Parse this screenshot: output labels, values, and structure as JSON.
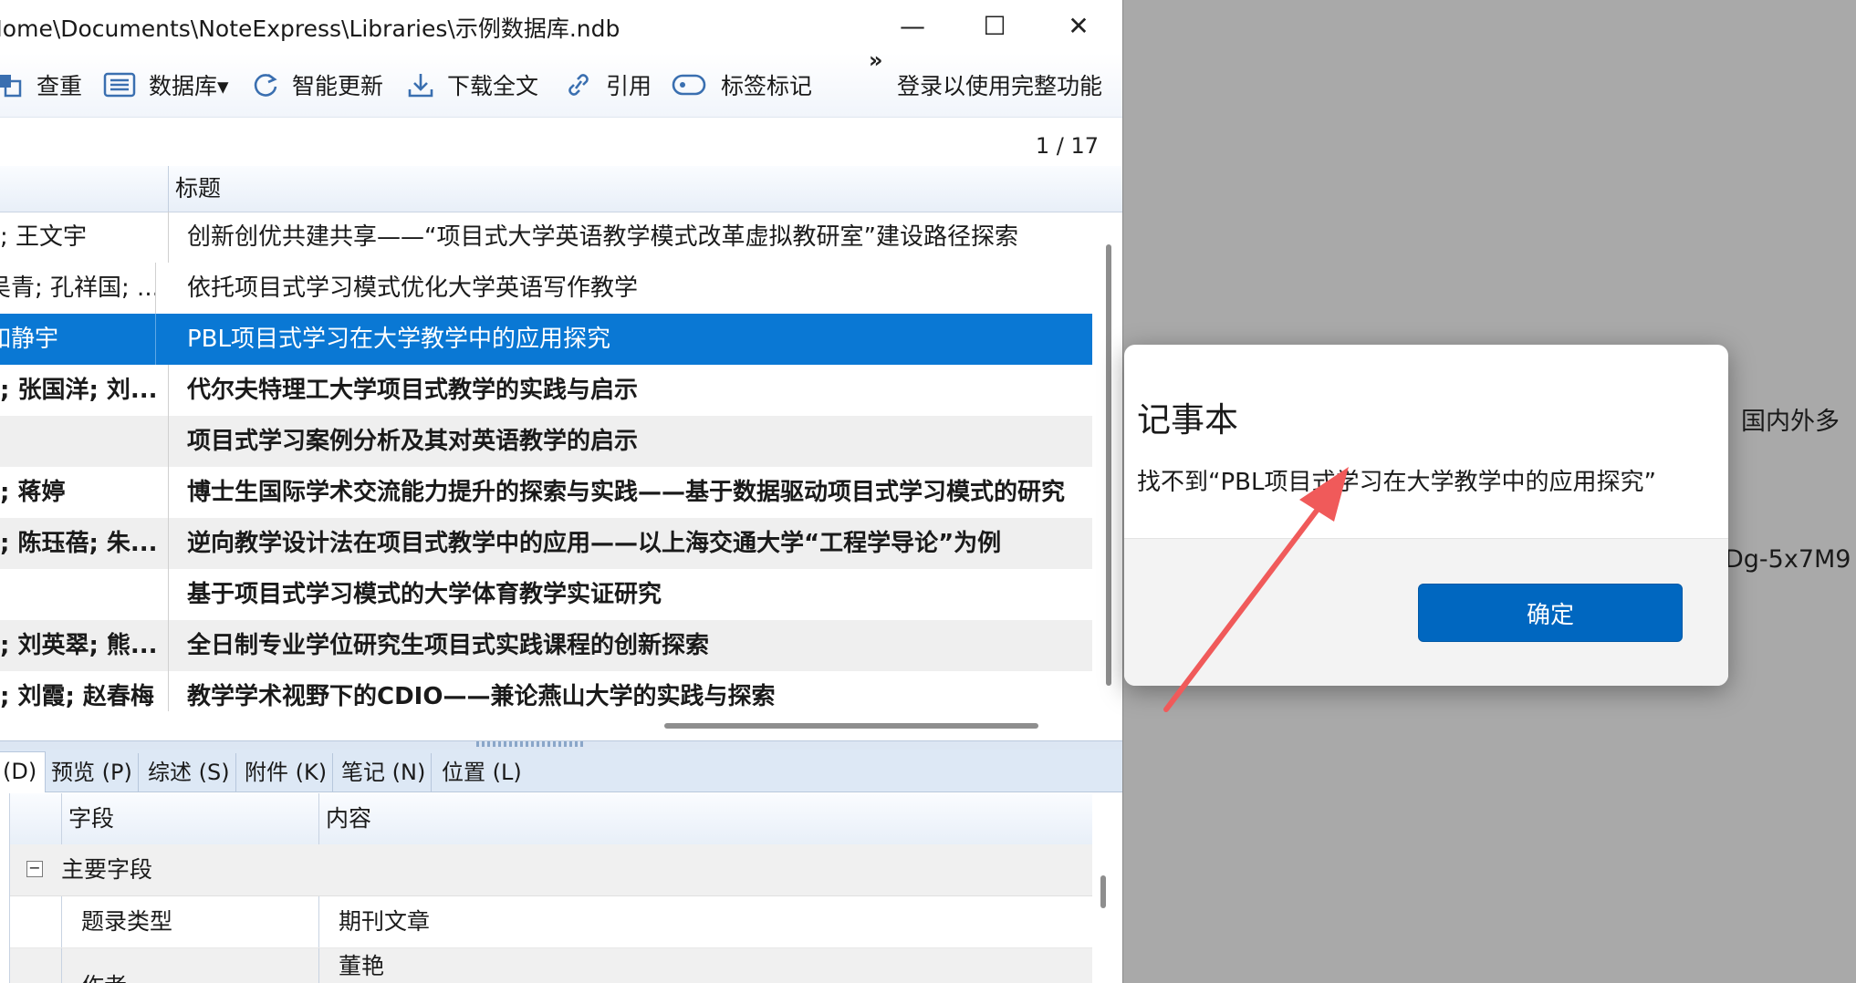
{
  "window": {
    "title": "Home\\Documents\\NoteExpress\\Libraries\\示例数据库.ndb",
    "minimize_glyph": "—",
    "maximize_glyph": "☐",
    "close_glyph": "✕"
  },
  "toolbar": {
    "items": [
      {
        "label": "查重",
        "icon": "duplicate-icon"
      },
      {
        "label": "数据库▾",
        "icon": "database-icon"
      },
      {
        "label": "智能更新",
        "icon": "refresh-icon"
      },
      {
        "label": "下载全文",
        "icon": "download-icon"
      },
      {
        "label": "引用",
        "icon": "link-icon"
      },
      {
        "label": "标签标记",
        "icon": "tag-icon"
      }
    ],
    "more": "»",
    "login": "登录以使用完整功能"
  },
  "pagination": "1 / 17",
  "list": {
    "title_header": "标题",
    "rows": [
      {
        "author": "; 王文宇",
        "title": "创新创优共建共享——“项目式大学英语教学模式改革虚拟教研室”建设路径探索"
      },
      {
        "author": "吴青; 孔祥国; ...",
        "title": "依托项目式学习模式优化大学英语写作教学"
      },
      {
        "author": "如静宇",
        "title": "PBL项目式学习在大学教学中的应用探究"
      },
      {
        "author": "; 张国洋; 刘...",
        "title": "代尔夫特理工大学项目式教学的实践与启示"
      },
      {
        "author": "",
        "title": "项目式学习案例分析及其对英语教学的启示"
      },
      {
        "author": "; 蒋婷",
        "title": "博士生国际学术交流能力提升的探索与实践——基于数据驱动项目式学习模式的研究"
      },
      {
        "author": "; 陈珏蓓; 朱...",
        "title": "逆向教学设计法在项目式教学中的应用——以上海交通大学“工程学导论”为例"
      },
      {
        "author": "",
        "title": "基于项目式学习模式的大学体育教学实证研究"
      },
      {
        "author": "; 刘英翠; 熊...",
        "title": "全日制专业学位研究生项目式实践课程的创新探索"
      },
      {
        "author": "; 刘霞; 赵春梅",
        "title": "教学学术视野下的CDIO——兼论燕山大学的实践与探索"
      }
    ]
  },
  "tabs": [
    "(D)",
    "预览 (P)",
    "综述 (S)",
    "附件 (K)",
    "笔记 (N)",
    "位置 (L)"
  ],
  "detail": {
    "field_header": "字段",
    "content_header": "内容",
    "group_toggle": "−",
    "group": "主要字段",
    "rows": [
      {
        "field": "题录类型",
        "value": "期刊文章"
      },
      {
        "field": "作者",
        "value": "董艳"
      }
    ]
  },
  "dialog": {
    "title": "记事本",
    "message": "找不到“PBL项目式学习在大学教学中的应用探究”",
    "ok": "确定"
  },
  "background": {
    "text1": "国内外多",
    "text2": "Dg-5x7M9"
  },
  "colors": {
    "selection": "#0a78d4",
    "ok_button": "#0067c0",
    "annotation_arrow": "#f05a5a"
  }
}
